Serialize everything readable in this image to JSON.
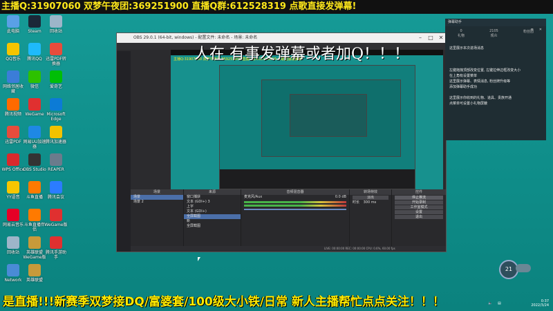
{
  "top_banner": "主播Q:31907060 双梦午夜团:369251900 直播Q群:612528319 点歌直接发弹幕!",
  "bottom_marquee": "是直播!!!新赛季双梦接DQ/富婆套/100级大小铁/日常 新人主播帮忙点点关注！！！",
  "overlay_question": "人在 有事发弹幕或者加Q！！！",
  "desktop_icons": [
    {
      "label": "此电脑",
      "color": "#5aa0e6"
    },
    {
      "label": "Steam",
      "color": "#1b2838"
    },
    {
      "label": "回收站",
      "color": "#9db5c9"
    },
    {
      "label": "QQ音乐",
      "color": "#f5c400"
    },
    {
      "label": "腾讯QQ",
      "color": "#1ebafc"
    },
    {
      "label": "迅雷PDF转换器",
      "color": "#e74c3c"
    },
    {
      "label": "网络邻居收藏",
      "color": "#3b7dd8"
    },
    {
      "label": "微信",
      "color": "#2dc100"
    },
    {
      "label": "爱奇艺",
      "color": "#00be06"
    },
    {
      "label": "腾讯视频",
      "color": "#ff6a00"
    },
    {
      "label": "WeGame",
      "color": "#e03030"
    },
    {
      "label": "Microsoft Edge",
      "color": "#0c7bd6"
    },
    {
      "label": "迅雷PDF",
      "color": "#e74c3c"
    },
    {
      "label": "网易UU加速器",
      "color": "#1e88e5"
    },
    {
      "label": "腾讯加速器",
      "color": "#f2c200"
    },
    {
      "label": "WPS Office",
      "color": "#d9292c"
    },
    {
      "label": "OBS Studio",
      "color": "#333333"
    },
    {
      "label": "REAPER",
      "color": "#6b7b8c"
    },
    {
      "label": "YY语音",
      "color": "#f7c600"
    },
    {
      "label": "斗鱼直播",
      "color": "#ff7a00"
    },
    {
      "label": "腾讯会议",
      "color": "#2b7cff"
    },
    {
      "label": "网易云音乐",
      "color": "#e60026"
    },
    {
      "label": "斗鱼直播伴侣",
      "color": "#ff7a00"
    },
    {
      "label": "WeGame版",
      "color": "#e03030"
    },
    {
      "label": "回收站",
      "color": "#9db5c9"
    },
    {
      "label": "英雄联盟WeGame版",
      "color": "#c79a3a"
    },
    {
      "label": "腾讯手游助手",
      "color": "#e03030"
    },
    {
      "label": "Network",
      "color": "#4a8bd6"
    },
    {
      "label": "英雄联盟",
      "color": "#c79a3a"
    }
  ],
  "obs": {
    "window_title": "OBS 29.0.1 (64-bit, windows) - 配置文件: 未命名 - 场景: 未命名",
    "scenes_title": "场景",
    "scenes": [
      "场景",
      "场景 2"
    ],
    "sources_title": "来源",
    "sources": [
      "窗口捕获",
      "文本 (GDI+) 3",
      "上字",
      "文本 (GDI+)",
      "全屏截图",
      "新",
      "全屏截图"
    ],
    "selected_source_index": 4,
    "mixer_title": "音频混音器",
    "mixer_channel": "麦克风/Aux",
    "mixer_db": "0.0 dB",
    "transitions_title": "转场特效",
    "transition_value": "淡出",
    "duration_label": "时长",
    "duration_value": "300 ms",
    "controls_title": "控件",
    "controls": [
      "停止推流",
      "开始录制",
      "工作室模式",
      "设置",
      "退出"
    ],
    "status": "LIVE: 00:00:00   REC: 00:00:00   CPU: 0.6%, 60.00 fps"
  },
  "chat": {
    "header": "弹幕助手",
    "tabs": [
      "礼物",
      "观众",
      "粉丝团"
    ],
    "counts": [
      "0",
      "2105",
      ""
    ],
    "messages": [
      "这里展示本次进场消息",
      "左键拖拽顶部改变位置, 左键拉伸边框改变大小",
      "在上角有设置菜单",
      "这里展示弹幕、表情消息, 粉丝牌升级等",
      "添加弹幕助手成功",
      "这里展示你收到的礼物、道具、贵族开通",
      "点菜单可设置小礼物屏蔽"
    ]
  },
  "speed_value": "21",
  "clock_time": "0:37",
  "clock_date": "2022/3/24",
  "colors": {
    "desktop": "#0f8f8c",
    "banner_text": "#ffe81a",
    "obs_bg": "#2b2b2e",
    "chat_bg": "#1f2d33"
  }
}
